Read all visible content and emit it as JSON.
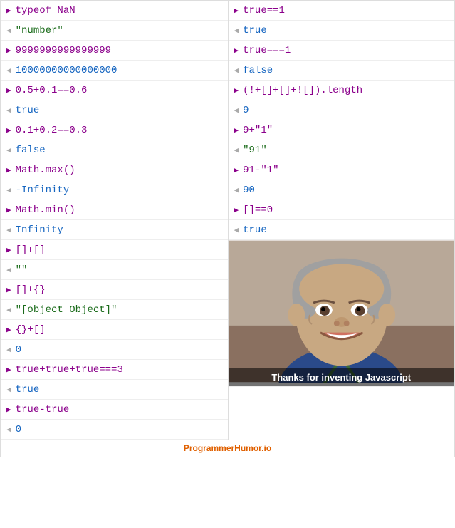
{
  "left_col": [
    {
      "type": "input",
      "code": "typeof NaN"
    },
    {
      "type": "output",
      "value": "\"number\"",
      "style": "string"
    },
    {
      "type": "input",
      "code": "9999999999999999"
    },
    {
      "type": "output",
      "value": "10000000000000000",
      "style": "number"
    },
    {
      "type": "input",
      "code": "0.5+0.1==0.6"
    },
    {
      "type": "output",
      "value": "true",
      "style": "bool"
    },
    {
      "type": "input",
      "code": "0.1+0.2==0.3"
    },
    {
      "type": "output",
      "value": "false",
      "style": "bool"
    },
    {
      "type": "input",
      "code": "Math.max()"
    },
    {
      "type": "output",
      "value": "-Infinity",
      "style": "neg"
    },
    {
      "type": "input",
      "code": "Math.min()"
    },
    {
      "type": "output",
      "value": "Infinity",
      "style": "special"
    },
    {
      "type": "input",
      "code": "[]+[]"
    },
    {
      "type": "output",
      "value": "\"\"",
      "style": "string"
    },
    {
      "type": "input",
      "code": "[]+{}"
    },
    {
      "type": "output",
      "value": "\"[object Object]\"",
      "style": "string"
    },
    {
      "type": "input",
      "code": "{}+[]"
    },
    {
      "type": "output",
      "value": "0",
      "style": "number"
    },
    {
      "type": "input",
      "code": "true+true+true===3"
    },
    {
      "type": "output",
      "value": "true",
      "style": "bool"
    },
    {
      "type": "input",
      "code": "true-true"
    },
    {
      "type": "output",
      "value": "0",
      "style": "number"
    }
  ],
  "right_col": [
    {
      "type": "input",
      "code": "true==1"
    },
    {
      "type": "output",
      "value": "true",
      "style": "bool"
    },
    {
      "type": "input",
      "code": "true===1"
    },
    {
      "type": "output",
      "value": "false",
      "style": "bool"
    },
    {
      "type": "input",
      "code": "(!+[]+[]+![]).length"
    },
    {
      "type": "output",
      "value": "9",
      "style": "number"
    },
    {
      "type": "input",
      "code": "9+\"1\""
    },
    {
      "type": "output",
      "value": "\"91\"",
      "style": "string"
    },
    {
      "type": "input",
      "code": "91-\"1\""
    },
    {
      "type": "output",
      "value": "90",
      "style": "number"
    },
    {
      "type": "input",
      "code": "[]==0"
    },
    {
      "type": "output",
      "value": "true",
      "style": "bool"
    }
  ],
  "meme_caption": "Thanks for inventing Javascript",
  "footer_text": "ProgrammerHumor.io"
}
